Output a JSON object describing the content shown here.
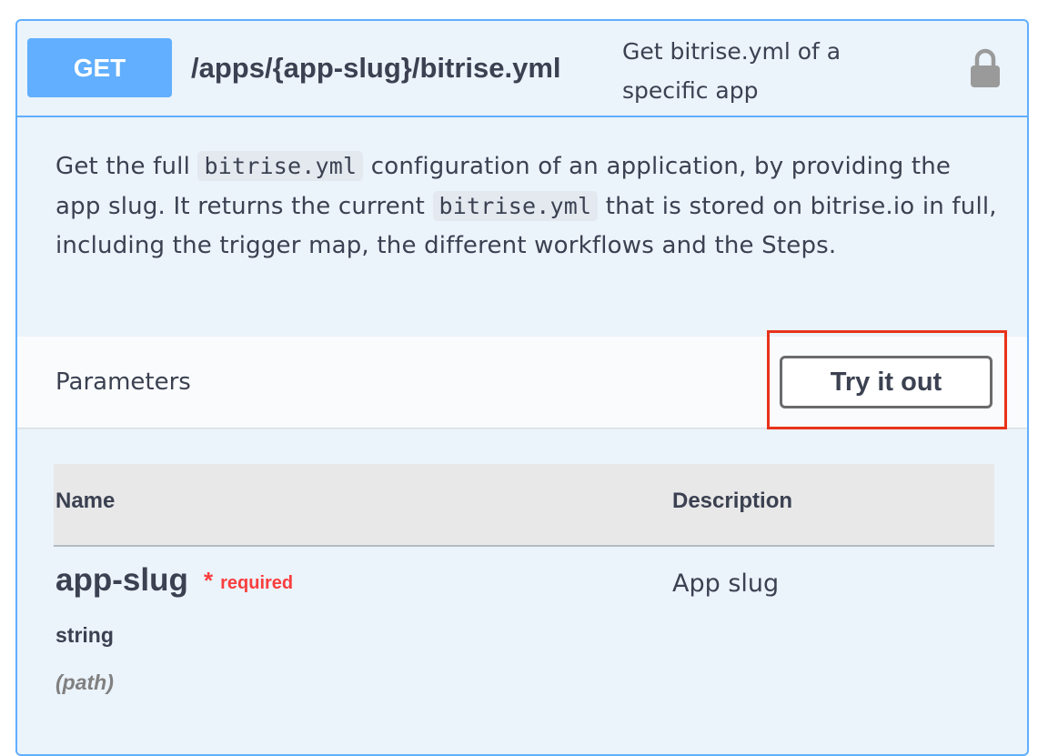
{
  "operation": {
    "method": "GET",
    "path": "/apps/{app-slug}/bitrise.yml",
    "summary": "Get bitrise.yml of a specific app",
    "lock_icon": "lock-icon",
    "colors": {
      "accent": "#61affe",
      "background": "#ebf3fb",
      "highlight_box": "#e8331a",
      "required": "#f93e3e"
    }
  },
  "description": {
    "part1": "Get the full ",
    "code1": "bitrise.yml",
    "part2": " configuration of an application, by providing the app slug. It returns the current ",
    "code2": "bitrise.yml",
    "part3": " that is stored on bitrise.io in full, including the trigger map, the different workflows and the Steps."
  },
  "parameters": {
    "title": "Parameters",
    "try_button_label": "Try it out",
    "columns": {
      "name": "Name",
      "description": "Description"
    },
    "rows": [
      {
        "name": "app-slug",
        "required_star": "*",
        "required_label": "required",
        "type": "string",
        "in": "(path)",
        "description": "App slug"
      }
    ]
  }
}
